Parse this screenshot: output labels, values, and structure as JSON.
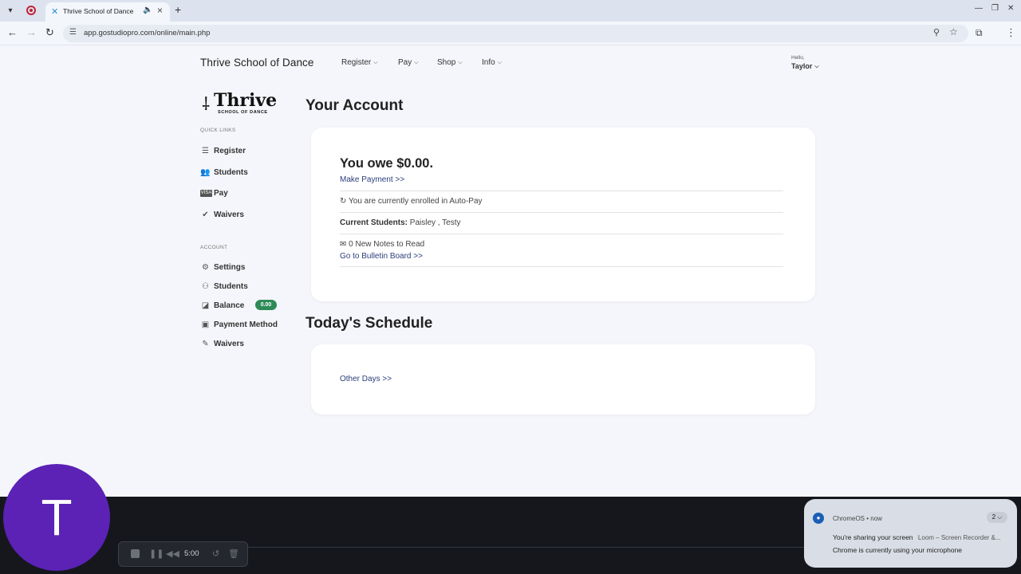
{
  "browser": {
    "tab_title": "Thrive School of Dance",
    "url": "app.gostudiopro.com/online/main.php"
  },
  "header": {
    "school_name": "Thrive School of Dance",
    "nav": [
      "Register",
      "Pay",
      "Shop",
      "Info"
    ],
    "greeting": "Hello,",
    "user_name": "Taylor"
  },
  "logo": {
    "word": "Thrive",
    "sub": "SCHOOL OF DANCE"
  },
  "sidebar": {
    "quick_links_heading": "QUICK LINKS",
    "quick_links": [
      {
        "label": "Register",
        "icon": "list-icon"
      },
      {
        "label": "Students",
        "icon": "users-icon"
      },
      {
        "label": "Pay",
        "icon": "visa-card-icon"
      },
      {
        "label": "Waivers",
        "icon": "check-icon"
      }
    ],
    "account_heading": "ACCOUNT",
    "account": [
      {
        "label": "Settings",
        "icon": "gear-icon"
      },
      {
        "label": "Students",
        "icon": "user-icon"
      },
      {
        "label": "Balance",
        "icon": "chart-icon"
      },
      {
        "label": "Payment Method",
        "icon": "wallet-icon"
      },
      {
        "label": "Waivers",
        "icon": "edit-icon"
      }
    ],
    "balance_badge": "0.00"
  },
  "account": {
    "title": "Your Account",
    "owe_text": "You owe $0.00.",
    "make_payment": "Make Payment >>",
    "autopay_text": "You are currently enrolled in Auto-Pay",
    "students_label": "Current Students:",
    "students_value": "Paisley , Testy",
    "notes_text": "0 New Notes to Read",
    "bulletin_link": "Go to Bulletin Board >>"
  },
  "schedule": {
    "title": "Today's Schedule",
    "other_days": "Other Days >>"
  },
  "recorder": {
    "avatar_letter": "T",
    "time": "5:00"
  },
  "notification": {
    "source": "ChromeOS",
    "when": "now",
    "count": "2",
    "title": "You're sharing your screen",
    "app": "Loom – Screen Recorder &...",
    "body": "Chrome is currently using your microphone"
  },
  "colors": {
    "badge_green": "#2e8b57",
    "link_blue": "#2c3e7a",
    "avatar_purple": "#5b22b5"
  }
}
